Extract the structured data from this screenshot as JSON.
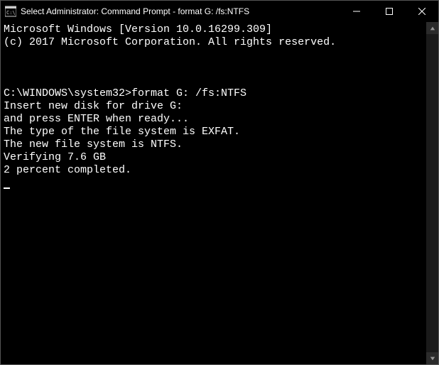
{
  "titlebar": {
    "text": "Select Administrator: Command Prompt - format  G: /fs:NTFS"
  },
  "terminal": {
    "line1": "Microsoft Windows [Version 10.0.16299.309]",
    "line2": "(c) 2017 Microsoft Corporation. All rights reserved.",
    "blank1": "",
    "blank2": "",
    "blank3": "",
    "prompt": "C:\\WINDOWS\\system32>",
    "command": "format G: /fs:NTFS",
    "out1": "Insert new disk for drive G:",
    "out2": "and press ENTER when ready...",
    "out3": "The type of the file system is EXFAT.",
    "out4": "The new file system is NTFS.",
    "out5": "Verifying 7.6 GB",
    "out6": "2 percent completed."
  }
}
